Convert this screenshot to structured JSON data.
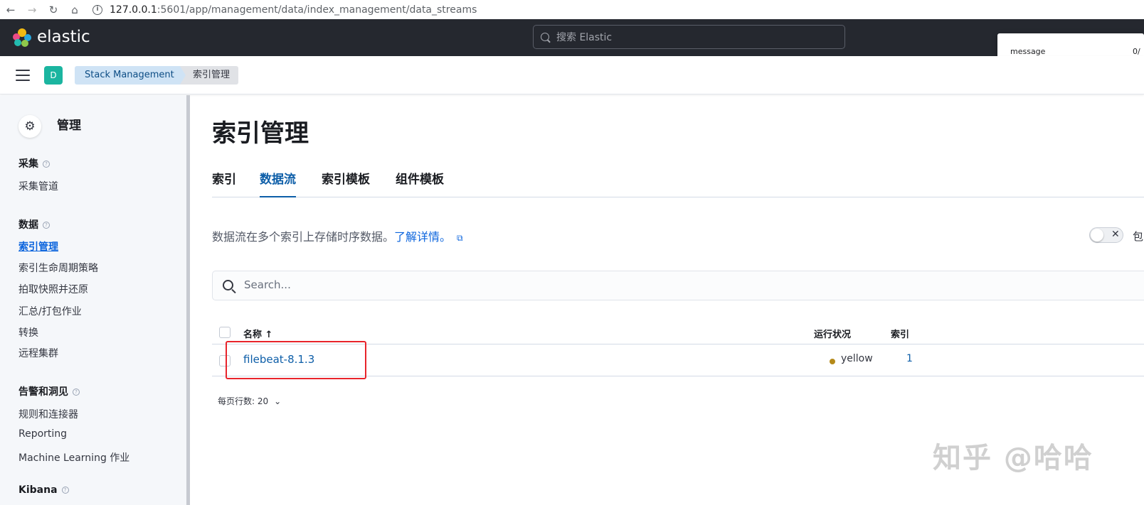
{
  "browser": {
    "back_icon": "arrow-left-icon",
    "forward_icon": "arrow-right-icon",
    "reload_icon": "reload-icon",
    "home_icon": "home-icon",
    "url_host": "127.0.0.1",
    "url_path": ":5601/app/management/data/index_management/data_streams"
  },
  "header": {
    "logo_text": "elastic",
    "search_placeholder": "搜索 Elastic",
    "popup_label": "message",
    "popup_count": "0/"
  },
  "subheader": {
    "space_initial": "D",
    "breadcrumbs": [
      "Stack Management",
      "索引管理"
    ]
  },
  "sidebar": {
    "title": "管理",
    "groups": [
      {
        "title": "采集",
        "items": [
          "采集管道"
        ]
      },
      {
        "title": "数据",
        "items": [
          "索引管理",
          "索引生命周期策略",
          "拍取快照并还原",
          "汇总/打包作业",
          "转换",
          "远程集群"
        ]
      },
      {
        "title": "告警和洞见",
        "items": [
          "规则和连接器",
          "Reporting",
          "Machine Learning 作业"
        ]
      },
      {
        "title": "Kibana",
        "items": []
      }
    ],
    "active_item": "索引管理"
  },
  "main": {
    "title": "索引管理",
    "tabs": [
      "索引",
      "数据流",
      "索引模板",
      "组件模板"
    ],
    "selected_tab": "数据流",
    "description": "数据流在多个索引上存储时序数据。",
    "learn_more": "了解详情。",
    "toggle_label": "包",
    "search_placeholder": "Search...",
    "columns": {
      "name": "名称 ↑",
      "health": "运行状况",
      "indices": "索引"
    },
    "rows": [
      {
        "name": "filebeat-8.1.3",
        "health": "yellow",
        "indices": "1"
      }
    ],
    "rows_per_page": "每页行数: 20"
  },
  "colors": {
    "header_bg": "#25282f",
    "accent": "#0d5ea8",
    "health_yellow": "#b58a1a",
    "highlight_box": "#e8242b",
    "space_avatar": "#1bb5a0"
  },
  "watermark": "知乎 @哈哈"
}
